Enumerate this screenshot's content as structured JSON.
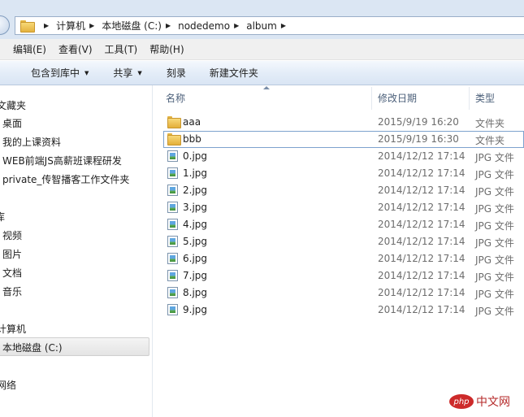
{
  "address": {
    "crumbs": [
      "计算机",
      "本地磁盘 (C:)",
      "nodedemo",
      "album"
    ]
  },
  "menubar": [
    "编辑(E)",
    "查看(V)",
    "工具(T)",
    "帮助(H)"
  ],
  "toolbar": {
    "include_library": "包含到库中",
    "share": "共享",
    "burn": "刻录",
    "new_folder": "新建文件夹"
  },
  "nav": {
    "favorites": "文藏夹",
    "desktop": "桌面",
    "course_materials": "我的上课资料",
    "web_course": "WEB前端JS高薪班课程研发",
    "private_folder": "private_传智播客工作文件夹",
    "libraries": "库",
    "videos": "视频",
    "pictures": "图片",
    "documents": "文档",
    "music": "音乐",
    "computer": "计算机",
    "local_disk": "本地磁盘 (C:)",
    "network": "网络"
  },
  "columns": {
    "name": "名称",
    "date": "修改日期",
    "type": "类型"
  },
  "files": [
    {
      "name": "aaa",
      "date": "2015/9/19 16:20",
      "type": "文件夹",
      "icon": "folder-icon"
    },
    {
      "name": "bbb",
      "date": "2015/9/19 16:30",
      "type": "文件夹",
      "icon": "folder-icon"
    },
    {
      "name": "0.jpg",
      "date": "2014/12/12 17:14",
      "type": "JPG 文件",
      "icon": "jpg-file-icon"
    },
    {
      "name": "1.jpg",
      "date": "2014/12/12 17:14",
      "type": "JPG 文件",
      "icon": "jpg-file-icon"
    },
    {
      "name": "2.jpg",
      "date": "2014/12/12 17:14",
      "type": "JPG 文件",
      "icon": "jpg-file-icon"
    },
    {
      "name": "3.jpg",
      "date": "2014/12/12 17:14",
      "type": "JPG 文件",
      "icon": "jpg-file-icon"
    },
    {
      "name": "4.jpg",
      "date": "2014/12/12 17:14",
      "type": "JPG 文件",
      "icon": "jpg-file-icon"
    },
    {
      "name": "5.jpg",
      "date": "2014/12/12 17:14",
      "type": "JPG 文件",
      "icon": "jpg-file-icon"
    },
    {
      "name": "6.jpg",
      "date": "2014/12/12 17:14",
      "type": "JPG 文件",
      "icon": "jpg-file-icon"
    },
    {
      "name": "7.jpg",
      "date": "2014/12/12 17:14",
      "type": "JPG 文件",
      "icon": "jpg-file-icon"
    },
    {
      "name": "8.jpg",
      "date": "2014/12/12 17:14",
      "type": "JPG 文件",
      "icon": "jpg-file-icon"
    },
    {
      "name": "9.jpg",
      "date": "2014/12/12 17:14",
      "type": "JPG 文件",
      "icon": "jpg-file-icon"
    }
  ],
  "watermark": {
    "badge": "php",
    "text": "中文网"
  }
}
